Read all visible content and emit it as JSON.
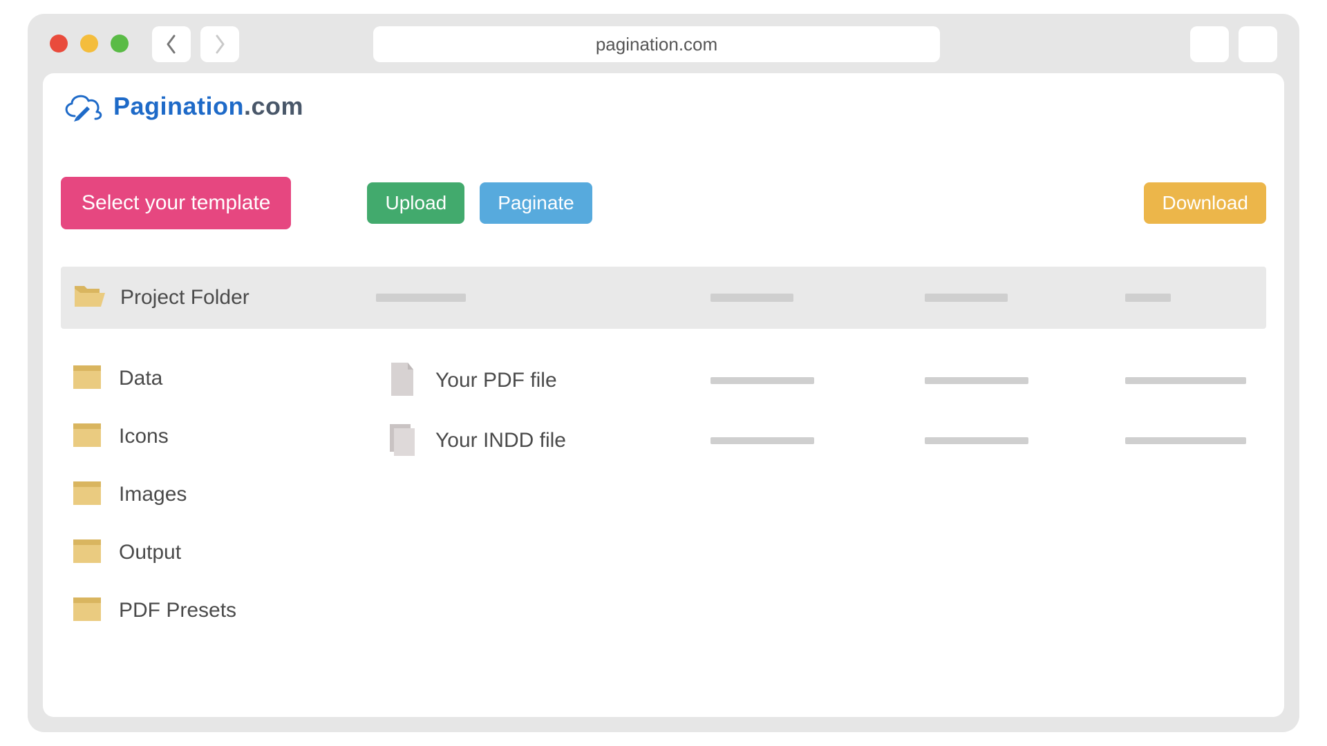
{
  "browser": {
    "url": "pagination.com"
  },
  "brand": {
    "name_primary": "Pagination",
    "name_secondary": ".com"
  },
  "buttons": {
    "select_template": "Select your template",
    "upload": "Upload",
    "paginate": "Paginate",
    "download": "Download"
  },
  "header": {
    "title": "Project Folder"
  },
  "folders": [
    {
      "name": "Data"
    },
    {
      "name": "Icons"
    },
    {
      "name": "Images"
    },
    {
      "name": "Output"
    },
    {
      "name": "PDF Presets"
    }
  ],
  "files": [
    {
      "name": "Your PDF file",
      "icon": "file-page"
    },
    {
      "name": "Your INDD file",
      "icon": "file-doc"
    }
  ],
  "colors": {
    "pink": "#e64780",
    "green": "#42aa6d",
    "blue": "#57aadd",
    "yellow": "#ecb64a",
    "brand_blue": "#1e6ac8",
    "folder": "#eacb80",
    "folder_dark": "#d9b55f"
  }
}
